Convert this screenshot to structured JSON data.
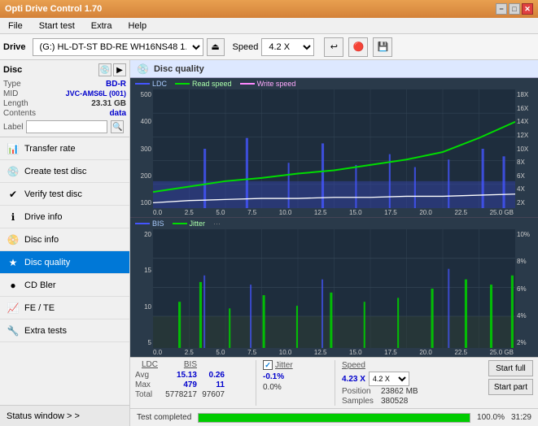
{
  "titleBar": {
    "title": "Opti Drive Control 1.70",
    "minimizeLabel": "−",
    "maximizeLabel": "□",
    "closeLabel": "✕"
  },
  "menuBar": {
    "items": [
      "File",
      "Start test",
      "Extra",
      "Help"
    ]
  },
  "toolbar": {
    "driveLabel": "Drive",
    "driveValue": "(G:)  HL-DT-ST BD-RE  WH16NS48 1.D3",
    "speedLabel": "Speed",
    "speedValue": "4.2 X"
  },
  "sidebar": {
    "discTitle": "Disc",
    "discType": {
      "label": "Type",
      "value": "BD-R"
    },
    "discMID": {
      "label": "MID",
      "value": "JVC-AMS6L (001)"
    },
    "discLength": {
      "label": "Length",
      "value": "23.31 GB"
    },
    "discContents": {
      "label": "Contents",
      "value": "data"
    },
    "discLabel": {
      "label": "Label",
      "placeholder": ""
    },
    "menuItems": [
      {
        "id": "transfer-rate",
        "label": "Transfer rate",
        "icon": "📊"
      },
      {
        "id": "create-test-disc",
        "label": "Create test disc",
        "icon": "💿"
      },
      {
        "id": "verify-test-disc",
        "label": "Verify test disc",
        "icon": "✔"
      },
      {
        "id": "drive-info",
        "label": "Drive info",
        "icon": "ℹ"
      },
      {
        "id": "disc-info",
        "label": "Disc info",
        "icon": "📀"
      },
      {
        "id": "disc-quality",
        "label": "Disc quality",
        "icon": "★",
        "active": true
      },
      {
        "id": "cd-bler",
        "label": "CD Bler",
        "icon": "🔵"
      },
      {
        "id": "fe-te",
        "label": "FE / TE",
        "icon": "📈"
      },
      {
        "id": "extra-tests",
        "label": "Extra tests",
        "icon": "🔧"
      }
    ],
    "statusWindowLabel": "Status window > >"
  },
  "discQuality": {
    "title": "Disc quality",
    "icon": "💿",
    "topChart": {
      "legends": [
        {
          "label": "LDC",
          "color": "#4455ff"
        },
        {
          "label": "Read speed",
          "color": "#00dd00"
        },
        {
          "label": "Write speed",
          "color": "#ff88ff"
        }
      ],
      "yAxisRight": [
        "18X",
        "16X",
        "14X",
        "12X",
        "10X",
        "8X",
        "6X",
        "4X",
        "2X"
      ],
      "yAxisLeft": [
        "500",
        "400",
        "300",
        "200",
        "100"
      ],
      "xAxis": [
        "0.0",
        "2.5",
        "5.0",
        "7.5",
        "10.0",
        "12.5",
        "15.0",
        "17.5",
        "20.0",
        "22.5",
        "25.0 GB"
      ]
    },
    "bottomChart": {
      "legends": [
        {
          "label": "BIS",
          "color": "#4455ff"
        },
        {
          "label": "Jitter",
          "color": "#00dd00"
        }
      ],
      "yAxisRight": [
        "10%",
        "8%",
        "6%",
        "4%",
        "2%"
      ],
      "yAxisLeft": [
        "20",
        "15",
        "10",
        "5"
      ],
      "xAxis": [
        "0.0",
        "2.5",
        "5.0",
        "7.5",
        "10.0",
        "12.5",
        "15.0",
        "17.5",
        "20.0",
        "22.5",
        "25.0 GB"
      ]
    },
    "stats": {
      "headers": [
        "LDC",
        "BIS",
        "",
        "Jitter",
        "Speed",
        ""
      ],
      "avg": {
        "label": "Avg",
        "ldc": "15.13",
        "bis": "0.26",
        "jitter": "-0.1%",
        "speed": "4.23 X"
      },
      "max": {
        "label": "Max",
        "ldc": "479",
        "bis": "11",
        "jitter": "0.0%",
        "position": "23862 MB"
      },
      "total": {
        "label": "Total",
        "ldc": "5778217",
        "bis": "97607",
        "samples": "380528"
      },
      "jitterChecked": true,
      "speedSelectValue": "4.2 X",
      "startFullLabel": "Start full",
      "startPartLabel": "Start part",
      "positionLabel": "Position",
      "samplesLabel": "Samples"
    }
  },
  "progressBar": {
    "percent": 100,
    "displayText": "100.0%",
    "timeText": "31:29",
    "statusLabel": "Test completed"
  }
}
